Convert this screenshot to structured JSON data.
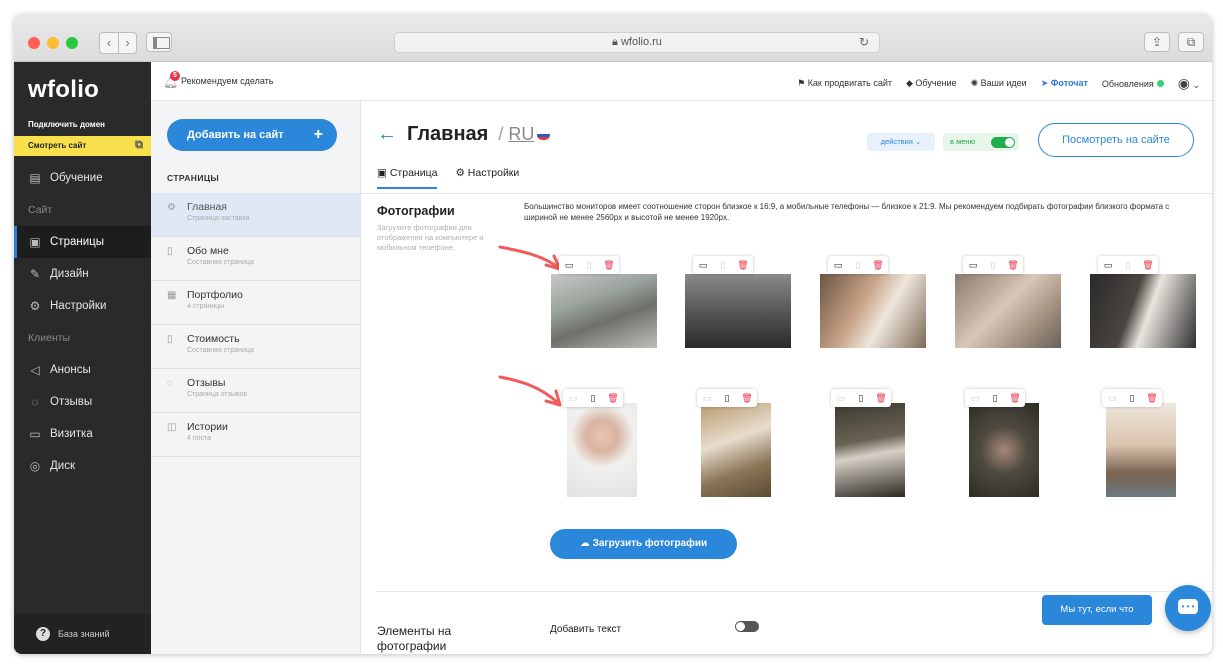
{
  "browser": {
    "url": "wfolio.ru"
  },
  "sidebar": {
    "logo": "wfolio",
    "connect_domain": "Подключить домен",
    "view_site": "Смотреть сайт",
    "items": [
      {
        "label": "Обучение",
        "icon": "book-icon"
      },
      {
        "label": "Сайт",
        "section": true
      },
      {
        "label": "Страницы",
        "icon": "page-icon"
      },
      {
        "label": "Дизайн",
        "icon": "brush-icon"
      },
      {
        "label": "Настройки",
        "icon": "gear-icon"
      },
      {
        "label": "Клиенты",
        "section": true
      },
      {
        "label": "Анонсы",
        "icon": "megaphone-icon"
      },
      {
        "label": "Отзывы",
        "icon": "chat-icon"
      },
      {
        "label": "Визитка",
        "icon": "card-icon"
      },
      {
        "label": "Диск",
        "icon": "disk-icon"
      }
    ],
    "knowledge_base": "База знаний"
  },
  "topbar": {
    "recommend": "Рекомендуем сделать",
    "badge": "5",
    "links": {
      "promote": "Как продвигать сайт",
      "learning": "Обучение",
      "ideas": "Ваши идеи",
      "photochat": "Фоточат",
      "updates": "Обновления"
    }
  },
  "pages_panel": {
    "add_button": "Добавить на сайт",
    "heading": "СТРАНИЦЫ",
    "pages": [
      {
        "title": "Главная",
        "subtitle": "Страница-заставка"
      },
      {
        "title": "Обо мне",
        "subtitle": "Составная страница"
      },
      {
        "title": "Портфолио",
        "subtitle": "4 страницы"
      },
      {
        "title": "Стоимость",
        "subtitle": "Составная страница"
      },
      {
        "title": "Отзывы",
        "subtitle": "Страница отзывов"
      },
      {
        "title": "Истории",
        "subtitle": "4 поста"
      }
    ]
  },
  "main": {
    "title": "Главная",
    "lang": "RU",
    "lang_prefix": "/",
    "actions": "действия",
    "in_menu": "в меню",
    "view_button": "Посмотреть на сайте",
    "tabs": {
      "page": "Страница",
      "settings": "Настройки"
    },
    "photos_title": "Фотографии",
    "photos_desc": "Загрузите фотографии для отображения на компьютере и мобильном телефоне.",
    "info": "Большинство мониторов имеет соотношение сторон близкое к 16:9, а мобильные телефоны — близкое к 21:9. Мы рекомендуем подбирать фотографии близкого формата с шириной не менее 2560px и высотой не менее 1920px.",
    "upload_button": "Загрузить фотографии",
    "elements_title": "Элементы на фотографии",
    "add_text": "Добавить текст",
    "chat_label": "Мы тут, если что"
  },
  "colors": {
    "accent": "#2b87d9",
    "sidebar": "#2a2a2a",
    "highlight": "#f7e04b",
    "danger": "#e8344a",
    "success": "#1fae4b"
  }
}
